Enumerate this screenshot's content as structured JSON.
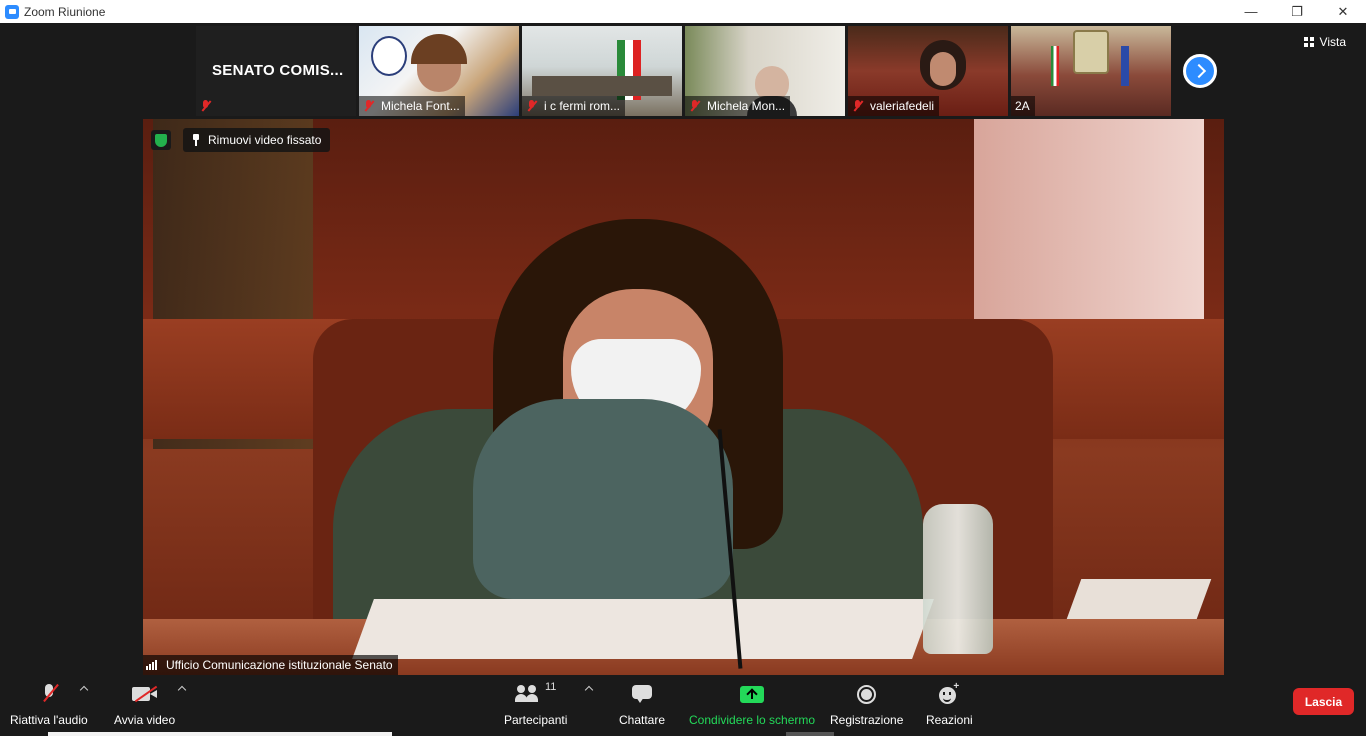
{
  "window": {
    "title": "Zoom Riunione",
    "minimize_glyph": "—",
    "restore_glyph": "❐",
    "close_glyph": "✕"
  },
  "view_button": {
    "label": "Vista",
    "icon": "grid-icon"
  },
  "thumbnails": [
    {
      "name": "SENATO  COMIS...",
      "type": "text",
      "muted": true
    },
    {
      "name": "Michela Font...",
      "type": "video",
      "muted": true
    },
    {
      "name": "i c fermi rom...",
      "type": "video",
      "muted": true
    },
    {
      "name": "Michela Mon...",
      "type": "video",
      "muted": true
    },
    {
      "name": "valeriafedeli",
      "type": "video",
      "muted": true
    },
    {
      "name": "2A",
      "type": "video",
      "muted": false
    }
  ],
  "main_video": {
    "pin_label": "Rimuovi video fissato",
    "speaker_name": "Ufficio Comunicazione istituzionale Senato"
  },
  "toolbar": {
    "audio_label": "Riattiva l'audio",
    "video_label": "Avvia video",
    "participants_label": "Partecipanti",
    "participants_count": "11",
    "chat_label": "Chattare",
    "share_label": "Condividere lo schermo",
    "record_label": "Registrazione",
    "reactions_label": "Reazioni",
    "leave_label": "Lascia"
  },
  "colors": {
    "accent": "#2d8cff",
    "share_green": "#23d959",
    "leave_red": "#e02828",
    "mute_red": "#e02828"
  }
}
